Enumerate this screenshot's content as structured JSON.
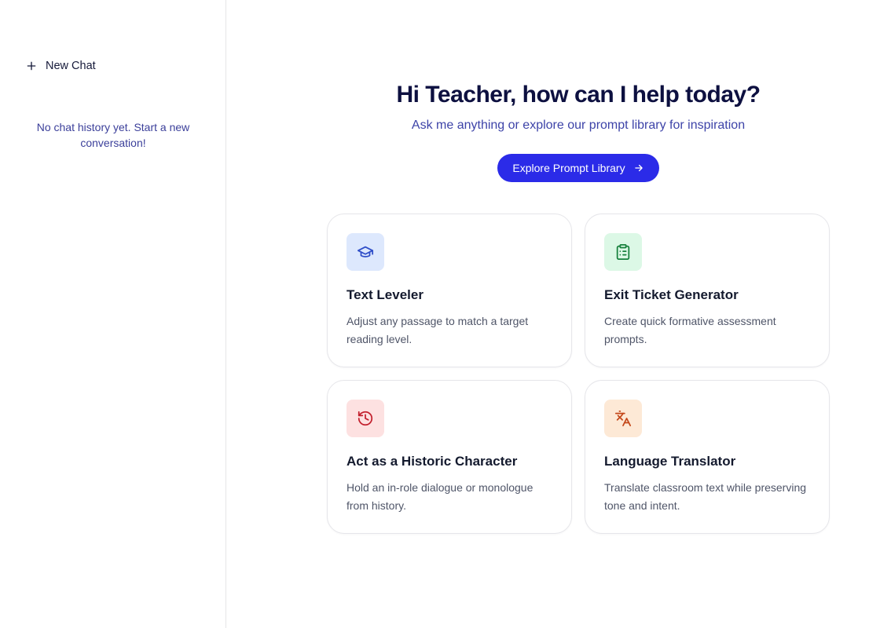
{
  "sidebar": {
    "new_chat_label": "New Chat",
    "empty_history": "No chat history yet. Start a new conversation!"
  },
  "hero": {
    "title": "Hi Teacher, how can I help today?",
    "subtitle": "Ask me anything or explore our prompt library for inspiration",
    "explore_button": "Explore Prompt Library"
  },
  "cards": [
    {
      "title": "Text Leveler",
      "description": "Adjust any passage to match a target reading level.",
      "icon": "graduation-cap-icon",
      "icon_bg": "#dde8fd",
      "icon_color": "#2f4ec8"
    },
    {
      "title": "Exit Ticket Generator",
      "description": "Create quick formative assessment prompts.",
      "icon": "clipboard-list-icon",
      "icon_bg": "#dcf8e6",
      "icon_color": "#16803c"
    },
    {
      "title": "Act as a Historic Character",
      "description": "Hold an in-role dialogue or monologue from history.",
      "icon": "history-icon",
      "icon_bg": "#fde1e1",
      "icon_color": "#c3202e"
    },
    {
      "title": "Language Translator",
      "description": "Translate classroom text while preserving tone and intent.",
      "icon": "languages-icon",
      "icon_bg": "#fde9d6",
      "icon_color": "#c4481a"
    }
  ],
  "colors": {
    "accent": "#2b2be8",
    "heading": "#0d1040",
    "subtext": "#3d43a8"
  }
}
